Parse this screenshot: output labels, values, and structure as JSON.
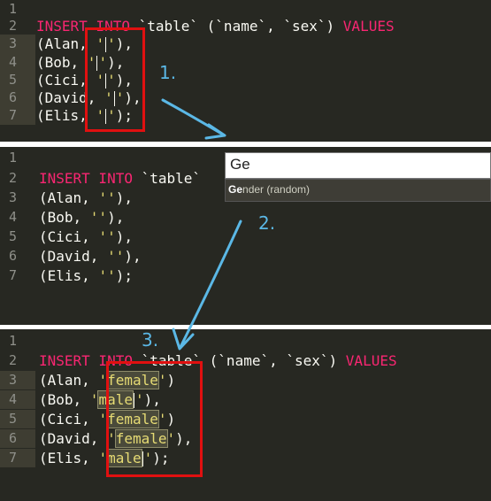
{
  "panel1": {
    "lines": [
      {
        "num": "1"
      },
      {
        "num": "2",
        "kw1": "INSERT INTO",
        "mid": " `table` (`name`, `sex`) ",
        "kw2": "VALUES"
      },
      {
        "num": "3",
        "pre": "(Alan, ",
        "q1": "'",
        "q2": "'",
        "post": "),"
      },
      {
        "num": "4",
        "pre": "(Bob, ",
        "q1": "'",
        "q2": "'",
        "post": "),"
      },
      {
        "num": "5",
        "pre": "(Cici, ",
        "q1": "'",
        "q2": "'",
        "post": "),"
      },
      {
        "num": "6",
        "pre": "(David, ",
        "q1": "'",
        "q2": "'",
        "post": "),"
      },
      {
        "num": "7",
        "pre": "(Elis, ",
        "q1": "'",
        "q2": "'",
        "post": ");"
      }
    ]
  },
  "panel2": {
    "lines": [
      {
        "num": "1"
      },
      {
        "num": "2",
        "kw1": "INSERT INTO",
        "mid": " `table`"
      },
      {
        "num": "3",
        "pre": "(Alan, ",
        "str": "''",
        "post": "),"
      },
      {
        "num": "4",
        "pre": "(Bob, ",
        "str": "''",
        "post": "),"
      },
      {
        "num": "5",
        "pre": "(Cici, ",
        "str": "''",
        "post": "),"
      },
      {
        "num": "6",
        "pre": "(David, ",
        "str": "''",
        "post": "),"
      },
      {
        "num": "7",
        "pre": "(Elis, ",
        "str": "''",
        "post": ");"
      }
    ],
    "popup": {
      "query": "Ge",
      "item_bold": "Ge",
      "item_rest": "nder (random)"
    }
  },
  "panel3": {
    "lines": [
      {
        "num": "1"
      },
      {
        "num": "2",
        "kw1": "INSERT INTO",
        "mid": " `table` (`name`, `sex`) ",
        "kw2": "VALUES"
      },
      {
        "num": "3",
        "pre": "(Alan, ",
        "q1": "'",
        "val": "female",
        "q2": "'",
        "post": ")"
      },
      {
        "num": "4",
        "pre": "(Bob, ",
        "q1": "'",
        "val": "male",
        "q2": "'",
        "post": "),"
      },
      {
        "num": "5",
        "pre": "(Cici, ",
        "q1": "'",
        "val": "female",
        "q2": "'",
        "post": ")"
      },
      {
        "num": "6",
        "pre": "(David, ",
        "q1": "'",
        "val": "female",
        "q2": "'",
        "post": "),"
      },
      {
        "num": "7",
        "pre": "(Elis, ",
        "q1": "'",
        "val": "male",
        "q2": "'",
        "post": ");"
      }
    ]
  },
  "annotations": {
    "step1": "1.",
    "step2": "2.",
    "step3": "3."
  },
  "colors": {
    "editor_bg": "#272822",
    "keyword": "#f92672",
    "string": "#e6db74",
    "annotation": "#5bb8e6",
    "highlight_box": "#e01010"
  }
}
